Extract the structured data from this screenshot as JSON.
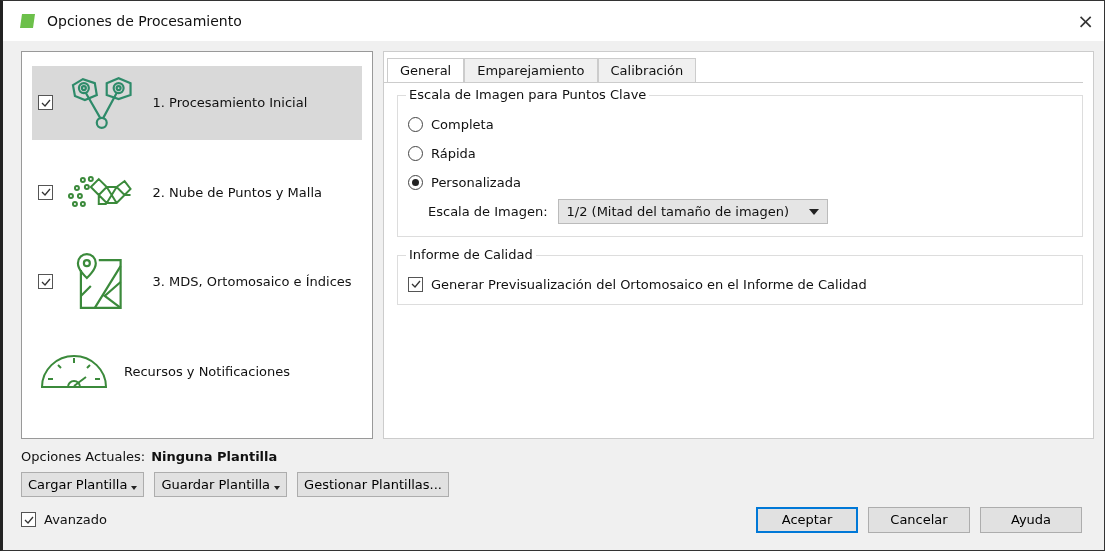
{
  "window": {
    "title": "Opciones de Procesamiento",
    "close": "×"
  },
  "steps": [
    {
      "kind": "cameras",
      "label": "1. Procesamiento Inicial",
      "checked": true,
      "selected": true
    },
    {
      "kind": "points",
      "label": "2. Nube de Puntos y Malla",
      "checked": true,
      "selected": false
    },
    {
      "kind": "map",
      "label": "3. MDS, Ortomosaico e Índices",
      "checked": true,
      "selected": false
    },
    {
      "kind": "gauge",
      "label": "Recursos y Notificaciones",
      "selected": false
    }
  ],
  "tabs": [
    {
      "label": "General",
      "selected": true
    },
    {
      "label": "Emparejamiento",
      "selected": false
    },
    {
      "label": "Calibración",
      "selected": false
    }
  ],
  "keypoints": {
    "title": "Escala de Imagen para Puntos Clave",
    "options": [
      {
        "label": "Completa",
        "selected": false
      },
      {
        "label": "Rápida",
        "selected": false
      },
      {
        "label": "Personalizada",
        "selected": true
      }
    ],
    "scale_label": "Escala de Imagen:",
    "scale_value": "1/2 (Mitad del tamaño de imagen)"
  },
  "quality": {
    "title": "Informe de Calidad",
    "option": {
      "label": "Generar Previsualización del Ortomosaico en el Informe de Calidad",
      "checked": true
    }
  },
  "current": {
    "label": "Opciones Actuales:",
    "value": "Ninguna Plantilla"
  },
  "template_buttons": [
    {
      "label": "Cargar Plantilla",
      "menu": true
    },
    {
      "label": "Guardar Plantilla",
      "menu": true
    },
    {
      "label": "Gestionar Plantillas...",
      "menu": false
    }
  ],
  "advanced": {
    "label": "Avanzado",
    "checked": true
  },
  "buttons": [
    {
      "label": "Aceptar",
      "default": true
    },
    {
      "label": "Cancelar",
      "default": false
    },
    {
      "label": "Ayuda",
      "default": false
    }
  ]
}
